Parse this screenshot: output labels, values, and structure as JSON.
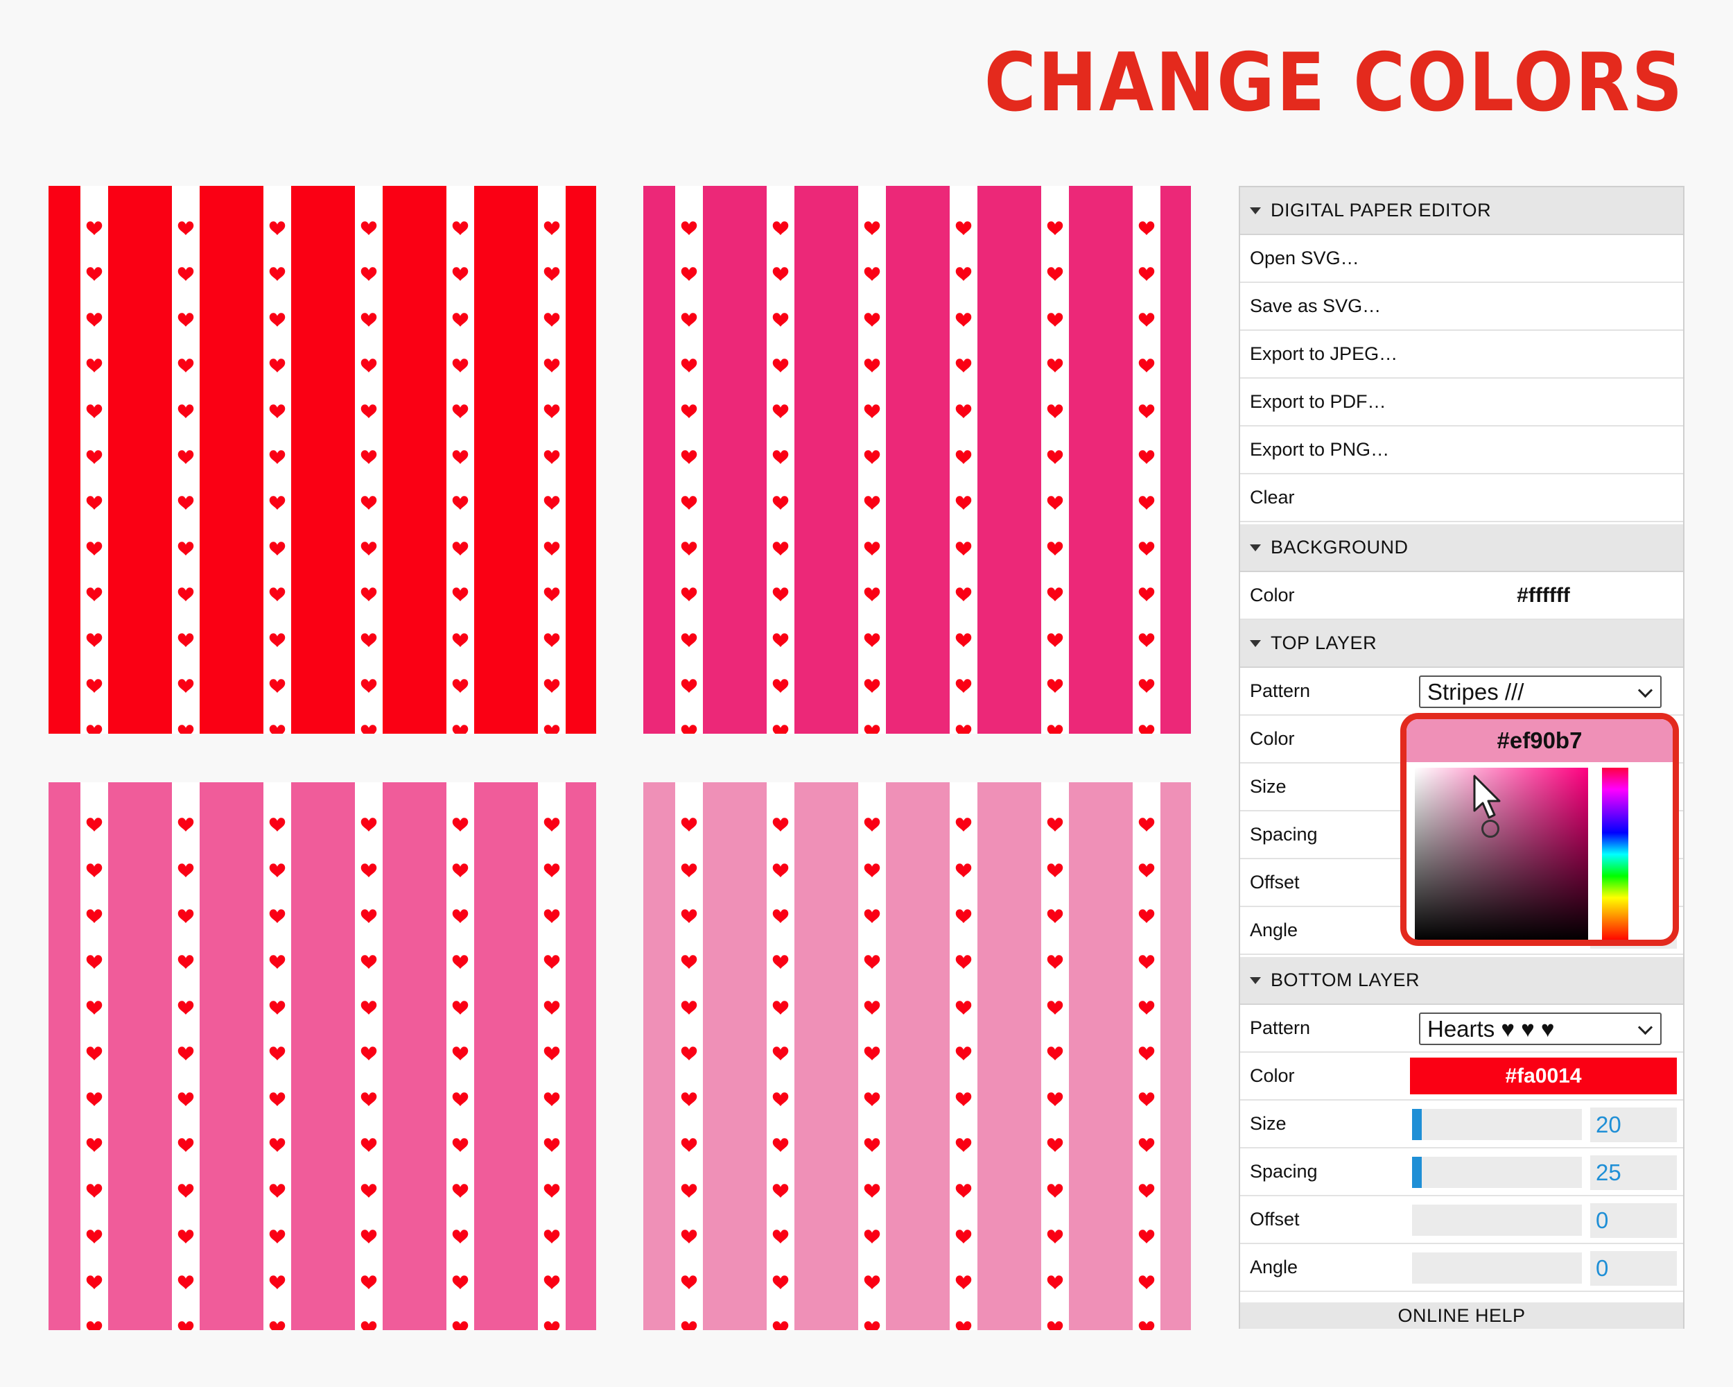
{
  "headline": "CHANGE COLORS",
  "swatches": [
    {
      "stripe_color": "#fa0014",
      "gap_color": "#ffffff",
      "heart_color": "#fa0014"
    },
    {
      "stripe_color": "#ec2878",
      "gap_color": "#ffffff",
      "heart_color": "#fa0014"
    },
    {
      "stripe_color": "#f05c9a",
      "gap_color": "#ffffff",
      "heart_color": "#fa0014"
    },
    {
      "stripe_color": "#ef90b7",
      "gap_color": "#ffffff",
      "heart_color": "#fa0014"
    }
  ],
  "panel": {
    "editor_header": "DIGITAL PAPER EDITOR",
    "menu": [
      "Open SVG…",
      "Save as SVG…",
      "Export to JPEG…",
      "Export to PDF…",
      "Export to PNG…",
      "Clear"
    ],
    "background_header": "BACKGROUND",
    "background_color_label": "Color",
    "background_color_value": "#ffffff",
    "top_header": "TOP LAYER",
    "top": {
      "pattern_label": "Pattern",
      "pattern_value": "Stripes  ///",
      "color_label": "Color",
      "size_label": "Size",
      "spacing_label": "Spacing",
      "offset_label": "Offset",
      "angle_label": "Angle"
    },
    "bottom_header": "BOTTOM LAYER",
    "bottom": {
      "pattern_label": "Pattern",
      "pattern_value": "Hearts  ♥  ♥  ♥",
      "color_label": "Color",
      "color_value": "#fa0014",
      "size_label": "Size",
      "size_value": "20",
      "spacing_label": "Spacing",
      "spacing_value": "25",
      "offset_label": "Offset",
      "offset_value": "0",
      "angle_label": "Angle",
      "angle_value": "0"
    },
    "help": "ONLINE HELP"
  },
  "picker": {
    "value": "#ef90b7"
  },
  "colors": {
    "accent": "#e42a1d",
    "slider": "#1f8fd6"
  }
}
